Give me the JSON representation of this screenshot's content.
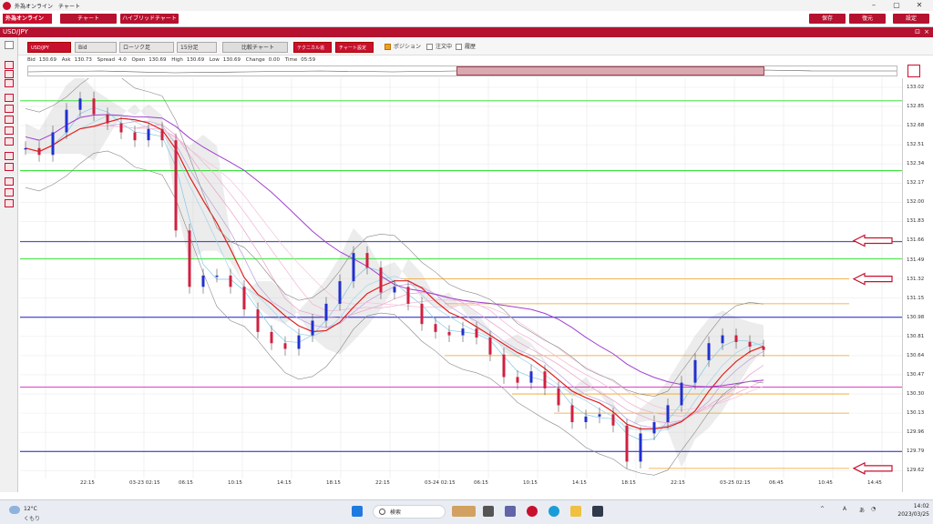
{
  "window": {
    "app_title": "外為オンライン",
    "doc_title": "チャート"
  },
  "menubar": {
    "logo": "外為オンライン",
    "chart_label": "チャート",
    "hybrid_label": "ハイブリッドチャート",
    "save_label": "保存",
    "restore_label": "復元",
    "settings_label": "設定"
  },
  "symbol_bar": {
    "symbol": "USD/JPY",
    "close": "×",
    "pin": "⊡"
  },
  "toolbar": {
    "pair": "USD/JPY",
    "price_type": "Bid",
    "chart_type": "ローソク足",
    "timeframe": "15分足",
    "compare_label": "比較チャート",
    "technical_label": "テクニカル追加",
    "chart_setting_label": "チャート設定",
    "position_label": "ポジション",
    "orders_label": "注文中",
    "history_label": "履歴"
  },
  "infobar": {
    "bid_label": "Bid",
    "bid": "130.69",
    "ask_label": "Ask",
    "ask": "130.73",
    "spread_label": "Spread",
    "spread": "4.0",
    "open_label": "Open",
    "open": "130.69",
    "high_label": "High",
    "high": "130.69",
    "low_label": "Low",
    "low": "130.69",
    "change_label": "Change",
    "change": "0.00",
    "time_label": "Time",
    "time": "05:59"
  },
  "chart_data": {
    "type": "line",
    "y_ticks": [
      "133.02",
      "132.85",
      "132.68",
      "132.51",
      "132.34",
      "132.17",
      "132.00",
      "131.83",
      "131.66",
      "131.49",
      "131.32",
      "131.15",
      "130.98",
      "130.81",
      "130.64",
      "130.47",
      "130.30",
      "130.13",
      "129.96",
      "129.79",
      "129.62"
    ],
    "x_ticks": [
      "22:15",
      "03-23 02:15",
      "06:15",
      "10:15",
      "14:15",
      "18:15",
      "22:15",
      "03-24 02:15",
      "06:15",
      "10:15",
      "14:15",
      "18:15",
      "22:15",
      "03-25 02:15",
      "06:45",
      "10:45",
      "14:45"
    ],
    "ylim": [
      129.55,
      133.1
    ],
    "colors": {
      "blue_line": "#1a1ac8",
      "green_line": "#22dd22",
      "magenta_line": "#e020c0",
      "orange_line": "#f0a020",
      "ma_red": "#e02020",
      "ma_purple": "#a040d0",
      "cloud": "#c8c8c8"
    },
    "series": [
      {
        "values": [
          132.48,
          132.42,
          132.62,
          132.82,
          132.92,
          132.78,
          132.7,
          132.62,
          132.55,
          132.65,
          132.55,
          131.75,
          131.25,
          131.35,
          131.35,
          131.25,
          131.05,
          130.85,
          130.75,
          130.7,
          130.82,
          130.95,
          131.1,
          131.3,
          131.55,
          131.42,
          131.2,
          131.25,
          131.1,
          130.92,
          130.85,
          130.82,
          130.88,
          130.8,
          130.65,
          130.45,
          130.4,
          130.5,
          130.35,
          130.2,
          130.05,
          130.1,
          130.12,
          130.02,
          129.7,
          129.95,
          130.05,
          130.2,
          130.4,
          130.6,
          130.75,
          130.82,
          130.76,
          130.72,
          130.69
        ]
      }
    ],
    "hlines": [
      {
        "value": 132.9,
        "color": "green"
      },
      {
        "value": 132.28,
        "color": "green"
      },
      {
        "value": 131.5,
        "color": "green"
      },
      {
        "value": 131.65,
        "color": "blue"
      },
      {
        "value": 130.98,
        "color": "blue"
      },
      {
        "value": 129.79,
        "color": "blue"
      },
      {
        "value": 130.36,
        "color": "magenta"
      }
    ]
  },
  "right_panel": {
    "toggle": "⇲"
  },
  "taskbar": {
    "temp": "12°C",
    "condition": "くもり",
    "search": "検索",
    "time": "14:02",
    "date": "2023/03/25",
    "ime": "A",
    "ime2": "あ"
  }
}
